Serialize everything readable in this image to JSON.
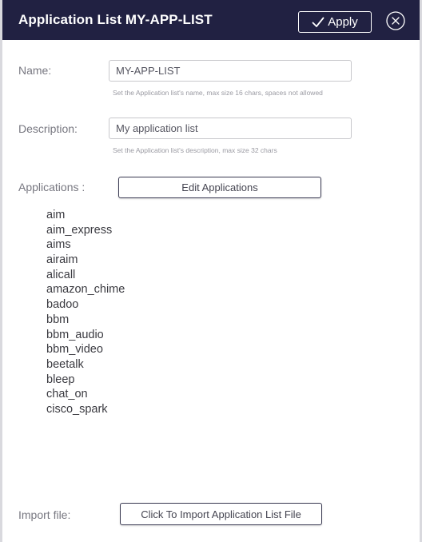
{
  "header": {
    "title": "Application List MY-APP-LIST",
    "apply_label": "Apply",
    "apply_icon": "checkmark-icon",
    "close_icon": "close-circle-icon",
    "background": "#212142"
  },
  "form": {
    "name": {
      "label": "Name:",
      "value": "MY-APP-LIST",
      "help": "Set the Application list's name, max size 16 chars, spaces not allowed"
    },
    "description": {
      "label": "Description:",
      "value": "My application list",
      "help": "Set the Application list's description, max size 32 chars"
    },
    "applications": {
      "label": "Applications :",
      "edit_button_label": "Edit Applications",
      "items": [
        "aim",
        "aim_express",
        "aims",
        "airaim",
        "alicall",
        "amazon_chime",
        "badoo",
        "bbm",
        "bbm_audio",
        "bbm_video",
        "beetalk",
        "bleep",
        "chat_on",
        "cisco_spark"
      ]
    },
    "import_file": {
      "label": "Import file:",
      "button_label": "Click To Import Application List File"
    }
  }
}
